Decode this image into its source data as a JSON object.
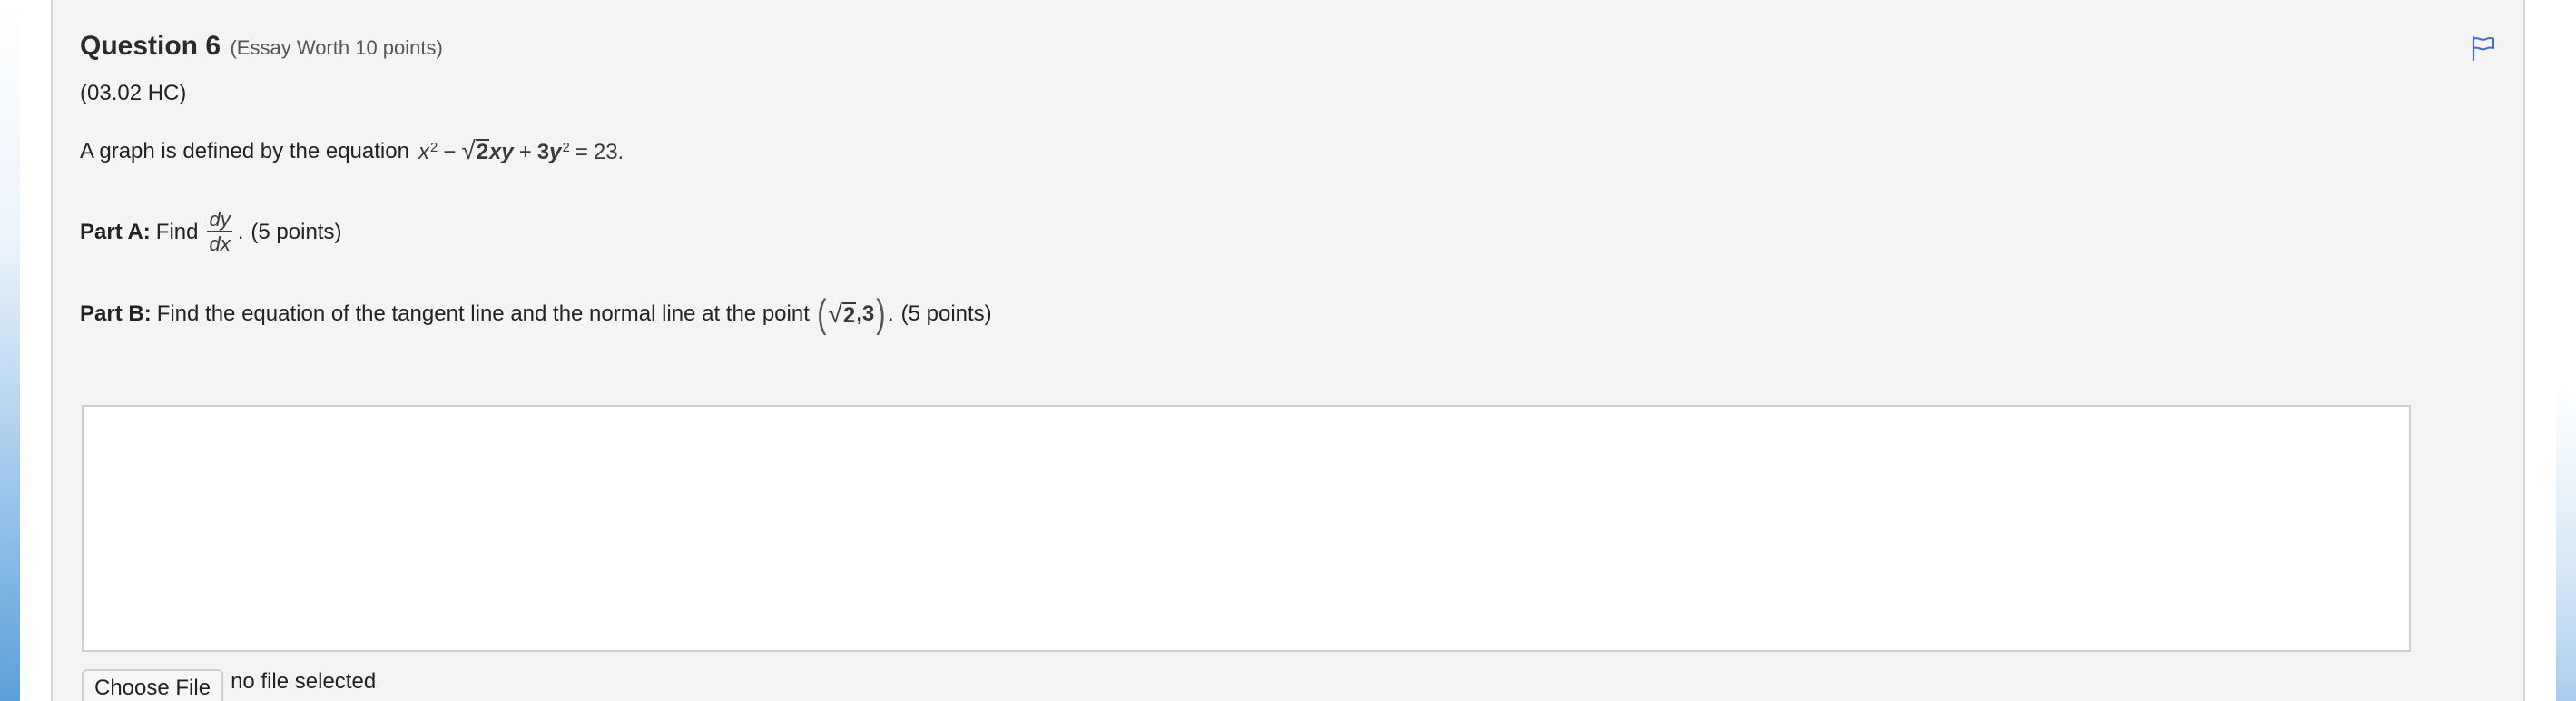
{
  "question": {
    "title": "Question 6",
    "worth": "(Essay Worth 10 points)",
    "code": "(03.02 HC)",
    "intro": "A graph is defined by the equation",
    "equation": {
      "x": "x",
      "x_exp": "2",
      "minus": "−",
      "sqrt_radicand": "2",
      "xy": "xy",
      "plus": "+",
      "coef": "3",
      "y": "y",
      "y_exp": "2",
      "equals": "=",
      "rhs": "23",
      "end": "."
    },
    "part_a": {
      "label": "Part A:",
      "text": "Find",
      "frac_num": "dy",
      "frac_den": "dx",
      "period": ".",
      "points": "(5 points)"
    },
    "part_b": {
      "label": "Part B:",
      "text": "Find the equation of the tangent line and the normal line at the point",
      "point_open": "(",
      "point_sqrt": "2",
      "point_rest": ",3",
      "point_close": ")",
      "period": ".",
      "points": "(5 points)"
    }
  },
  "answer": {
    "value": ""
  },
  "file_upload": {
    "button_label": "Choose File",
    "status": "no file selected"
  },
  "icons": {
    "flag": "flag-icon"
  },
  "colors": {
    "card_background": "#f4f4f4",
    "flag_blue": "#3f6fd1",
    "edge_blue": "#5c9fd8"
  }
}
